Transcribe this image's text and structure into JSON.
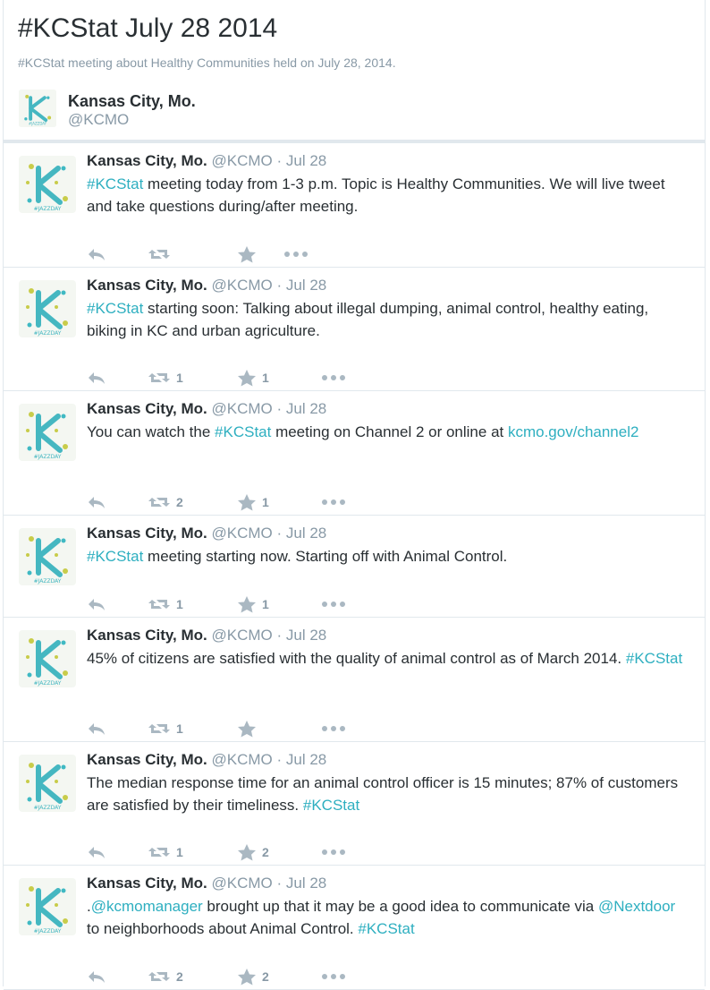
{
  "page": {
    "title": "#KCStat July 28 2014",
    "subtitle": "#KCStat meeting about Healthy Communities held on July 28, 2014."
  },
  "curator": {
    "name": "Kansas City, Mo.",
    "handle": "@KCMO"
  },
  "colors": {
    "link": "#2eafc0",
    "muted": "#8899a6",
    "text": "#292f33",
    "divider": "#e1e8ed"
  },
  "tweets": [
    {
      "name": "Kansas City, Mo.",
      "handle": "@KCMO",
      "sep": " · ",
      "time": "Jul 28",
      "parts": [
        {
          "t": "#KCStat",
          "link": true
        },
        {
          "t": " meeting today from 1-3 p.m. Topic is Healthy Communities. We will live tweet and take questions during/after meeting."
        }
      ],
      "retweets": "",
      "favorites": ""
    },
    {
      "name": "Kansas City, Mo.",
      "handle": "@KCMO",
      "sep": " · ",
      "time": "Jul 28",
      "parts": [
        {
          "t": "#KCStat",
          "link": true
        },
        {
          "t": " starting soon: Talking about illegal dumping, animal control, healthy eating, biking in KC and urban agriculture."
        }
      ],
      "retweets": "1",
      "favorites": "1"
    },
    {
      "name": "Kansas City, Mo.",
      "handle": "@KCMO",
      "sep": " · ",
      "time": "Jul 28",
      "parts": [
        {
          "t": "You can watch the "
        },
        {
          "t": "#KCStat",
          "link": true
        },
        {
          "t": " meeting on Channel 2 or online at "
        },
        {
          "t": "kcmo.gov/channel2",
          "link": true
        }
      ],
      "retweets": "2",
      "favorites": "1"
    },
    {
      "name": "Kansas City, Mo.",
      "handle": "@KCMO",
      "sep": " · ",
      "time": "Jul 28",
      "parts": [
        {
          "t": "#KCStat",
          "link": true
        },
        {
          "t": " meeting starting now. Starting off with Animal Control."
        }
      ],
      "retweets": "1",
      "favorites": "1"
    },
    {
      "name": "Kansas City, Mo.",
      "handle": "@KCMO",
      "sep": " · ",
      "time": "Jul 28",
      "parts": [
        {
          "t": "45% of citizens are satisfied with the quality of animal control as of March 2014. "
        },
        {
          "t": "#KCStat",
          "link": true
        }
      ],
      "retweets": "1",
      "favorites": ""
    },
    {
      "name": "Kansas City, Mo.",
      "handle": "@KCMO",
      "sep": " · ",
      "time": "Jul 28",
      "parts": [
        {
          "t": "The median response time for an animal control officer is 15 minutes; 87% of customers are satisfied by their timeliness. "
        },
        {
          "t": "#KCStat",
          "link": true
        }
      ],
      "retweets": "1",
      "favorites": "2"
    },
    {
      "name": "Kansas City, Mo.",
      "handle": "@KCMO",
      "sep": " · ",
      "time": "Jul 28",
      "parts": [
        {
          "t": "."
        },
        {
          "t": "@kcmomanager",
          "link": true
        },
        {
          "t": " brought up that it may be a good idea to communicate via "
        },
        {
          "t": "@Nextdoor",
          "link": true
        },
        {
          "t": " to neighborhoods about Animal Control. "
        },
        {
          "t": "#KCStat",
          "link": true
        }
      ],
      "retweets": "2",
      "favorites": "2"
    }
  ]
}
